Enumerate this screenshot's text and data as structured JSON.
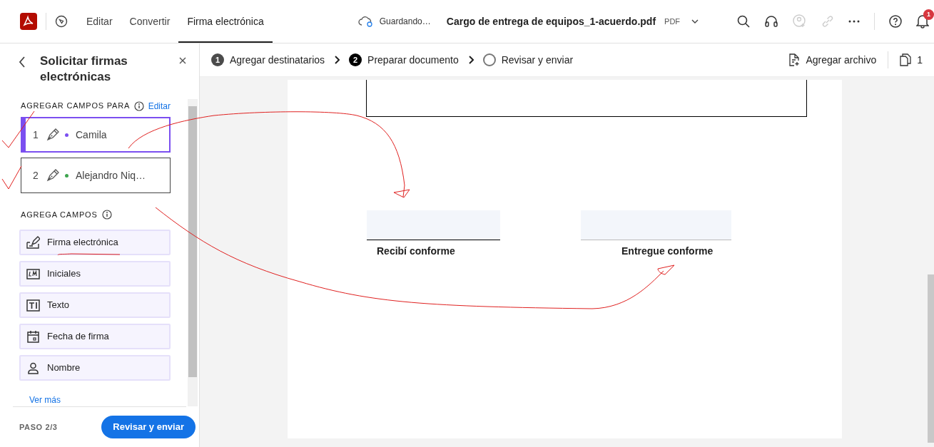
{
  "app_bar": {
    "menu": [
      {
        "label": "Editar",
        "selected": false
      },
      {
        "label": "Convertir",
        "selected": false
      },
      {
        "label": "Firma electrónica",
        "selected": true
      }
    ],
    "save_status": "Guardando…",
    "file_name": "Cargo de entrega de equipos_1-acuerdo.pdf",
    "file_type": "PDF",
    "notification_badge": "1"
  },
  "steps": [
    {
      "number": "1",
      "label": "Agregar destinatarios",
      "completed": true,
      "current": false
    },
    {
      "number": "2",
      "label": "Preparar documento",
      "completed": false,
      "current": true
    },
    {
      "label": "Revisar y enviar",
      "completed": false,
      "current": false
    }
  ],
  "toolbar": {
    "add_file": "Agregar archivo",
    "page_count": "1"
  },
  "panel": {
    "title": "Solicitar firmas electrónicas",
    "recipients_heading": "AGREGAR CAMPOS PARA",
    "edit_link": "Editar",
    "recipients": [
      {
        "number": "1",
        "name": "Camila",
        "color": "#7b4ff0",
        "selected": true
      },
      {
        "number": "2",
        "name": "Alejandro Niq…",
        "color": "#3ea44e",
        "selected": false
      }
    ],
    "fields_heading": "AGREGA CAMPOS",
    "fields": [
      {
        "kind": "signature",
        "label": "Firma electrónica"
      },
      {
        "kind": "initials",
        "label": "Iniciales"
      },
      {
        "kind": "text",
        "label": "Texto"
      },
      {
        "kind": "date",
        "label": "Fecha de firma"
      },
      {
        "kind": "name",
        "label": "Nombre"
      }
    ],
    "more_link": "Ver más",
    "step": "PASO 2/3",
    "next_button": "Revisar y enviar"
  },
  "document": {
    "signature_labels": [
      "Recibí conforme",
      "Entregue conforme"
    ]
  }
}
